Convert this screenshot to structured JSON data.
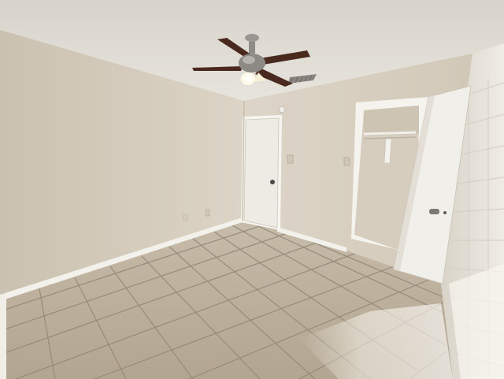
{
  "scene": {
    "subject": "empty-bedroom-interior",
    "elements": [
      "textured-ceiling",
      "ceiling-fan-with-light",
      "closed-door",
      "open-closet-door",
      "closet-rod",
      "tile-floor",
      "baseboards",
      "light-switch",
      "outlet",
      "ac-vent",
      "sunlight-patch"
    ]
  },
  "colors": {
    "ceiling": "#e5e2da",
    "wall_left": "#d6cdbd",
    "wall_back": "#dbd2c3",
    "wall_right_brick": "#e8e4dc",
    "floor_tile": "#b8ab98",
    "grout": "#8f8474",
    "door": "#f1efea",
    "baseboard": "#f3f1ec",
    "fan_blade": "#4a2a1e",
    "fan_metal": "#8f8c88"
  }
}
